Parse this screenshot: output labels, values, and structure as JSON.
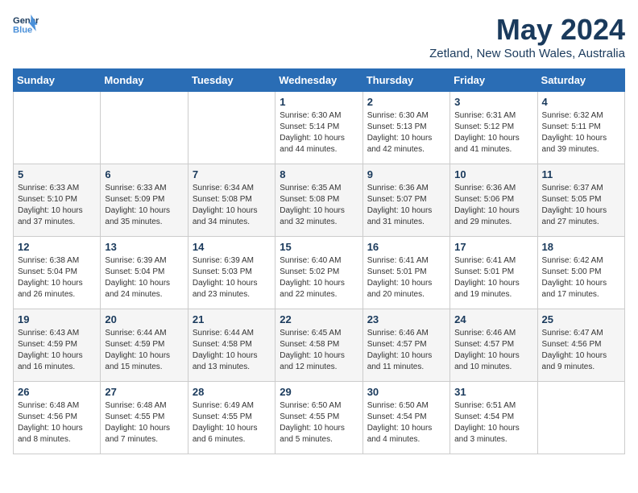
{
  "header": {
    "logo_line1": "General",
    "logo_line2": "Blue",
    "month": "May 2024",
    "location": "Zetland, New South Wales, Australia"
  },
  "weekdays": [
    "Sunday",
    "Monday",
    "Tuesday",
    "Wednesday",
    "Thursday",
    "Friday",
    "Saturday"
  ],
  "weeks": [
    [
      {
        "day": "",
        "info": ""
      },
      {
        "day": "",
        "info": ""
      },
      {
        "day": "",
        "info": ""
      },
      {
        "day": "1",
        "info": "Sunrise: 6:30 AM\nSunset: 5:14 PM\nDaylight: 10 hours\nand 44 minutes."
      },
      {
        "day": "2",
        "info": "Sunrise: 6:30 AM\nSunset: 5:13 PM\nDaylight: 10 hours\nand 42 minutes."
      },
      {
        "day": "3",
        "info": "Sunrise: 6:31 AM\nSunset: 5:12 PM\nDaylight: 10 hours\nand 41 minutes."
      },
      {
        "day": "4",
        "info": "Sunrise: 6:32 AM\nSunset: 5:11 PM\nDaylight: 10 hours\nand 39 minutes."
      }
    ],
    [
      {
        "day": "5",
        "info": "Sunrise: 6:33 AM\nSunset: 5:10 PM\nDaylight: 10 hours\nand 37 minutes."
      },
      {
        "day": "6",
        "info": "Sunrise: 6:33 AM\nSunset: 5:09 PM\nDaylight: 10 hours\nand 35 minutes."
      },
      {
        "day": "7",
        "info": "Sunrise: 6:34 AM\nSunset: 5:08 PM\nDaylight: 10 hours\nand 34 minutes."
      },
      {
        "day": "8",
        "info": "Sunrise: 6:35 AM\nSunset: 5:08 PM\nDaylight: 10 hours\nand 32 minutes."
      },
      {
        "day": "9",
        "info": "Sunrise: 6:36 AM\nSunset: 5:07 PM\nDaylight: 10 hours\nand 31 minutes."
      },
      {
        "day": "10",
        "info": "Sunrise: 6:36 AM\nSunset: 5:06 PM\nDaylight: 10 hours\nand 29 minutes."
      },
      {
        "day": "11",
        "info": "Sunrise: 6:37 AM\nSunset: 5:05 PM\nDaylight: 10 hours\nand 27 minutes."
      }
    ],
    [
      {
        "day": "12",
        "info": "Sunrise: 6:38 AM\nSunset: 5:04 PM\nDaylight: 10 hours\nand 26 minutes."
      },
      {
        "day": "13",
        "info": "Sunrise: 6:39 AM\nSunset: 5:04 PM\nDaylight: 10 hours\nand 24 minutes."
      },
      {
        "day": "14",
        "info": "Sunrise: 6:39 AM\nSunset: 5:03 PM\nDaylight: 10 hours\nand 23 minutes."
      },
      {
        "day": "15",
        "info": "Sunrise: 6:40 AM\nSunset: 5:02 PM\nDaylight: 10 hours\nand 22 minutes."
      },
      {
        "day": "16",
        "info": "Sunrise: 6:41 AM\nSunset: 5:01 PM\nDaylight: 10 hours\nand 20 minutes."
      },
      {
        "day": "17",
        "info": "Sunrise: 6:41 AM\nSunset: 5:01 PM\nDaylight: 10 hours\nand 19 minutes."
      },
      {
        "day": "18",
        "info": "Sunrise: 6:42 AM\nSunset: 5:00 PM\nDaylight: 10 hours\nand 17 minutes."
      }
    ],
    [
      {
        "day": "19",
        "info": "Sunrise: 6:43 AM\nSunset: 4:59 PM\nDaylight: 10 hours\nand 16 minutes."
      },
      {
        "day": "20",
        "info": "Sunrise: 6:44 AM\nSunset: 4:59 PM\nDaylight: 10 hours\nand 15 minutes."
      },
      {
        "day": "21",
        "info": "Sunrise: 6:44 AM\nSunset: 4:58 PM\nDaylight: 10 hours\nand 13 minutes."
      },
      {
        "day": "22",
        "info": "Sunrise: 6:45 AM\nSunset: 4:58 PM\nDaylight: 10 hours\nand 12 minutes."
      },
      {
        "day": "23",
        "info": "Sunrise: 6:46 AM\nSunset: 4:57 PM\nDaylight: 10 hours\nand 11 minutes."
      },
      {
        "day": "24",
        "info": "Sunrise: 6:46 AM\nSunset: 4:57 PM\nDaylight: 10 hours\nand 10 minutes."
      },
      {
        "day": "25",
        "info": "Sunrise: 6:47 AM\nSunset: 4:56 PM\nDaylight: 10 hours\nand 9 minutes."
      }
    ],
    [
      {
        "day": "26",
        "info": "Sunrise: 6:48 AM\nSunset: 4:56 PM\nDaylight: 10 hours\nand 8 minutes."
      },
      {
        "day": "27",
        "info": "Sunrise: 6:48 AM\nSunset: 4:55 PM\nDaylight: 10 hours\nand 7 minutes."
      },
      {
        "day": "28",
        "info": "Sunrise: 6:49 AM\nSunset: 4:55 PM\nDaylight: 10 hours\nand 6 minutes."
      },
      {
        "day": "29",
        "info": "Sunrise: 6:50 AM\nSunset: 4:55 PM\nDaylight: 10 hours\nand 5 minutes."
      },
      {
        "day": "30",
        "info": "Sunrise: 6:50 AM\nSunset: 4:54 PM\nDaylight: 10 hours\nand 4 minutes."
      },
      {
        "day": "31",
        "info": "Sunrise: 6:51 AM\nSunset: 4:54 PM\nDaylight: 10 hours\nand 3 minutes."
      },
      {
        "day": "",
        "info": ""
      }
    ]
  ]
}
